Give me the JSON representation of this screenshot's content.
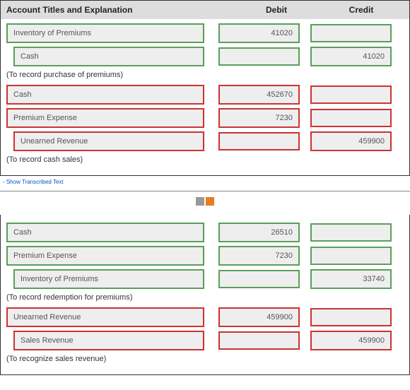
{
  "header": {
    "account_titles": "Account Titles and Explanation",
    "debit": "Debit",
    "credit": "Credit"
  },
  "section1": {
    "rows": [
      {
        "account": "Inventory of Premiums",
        "debit": "41020",
        "credit": "",
        "status": "green"
      },
      {
        "account": "Cash",
        "debit": "",
        "credit": "41020",
        "status": "green"
      }
    ],
    "caption": "(To record purchase of premiums)"
  },
  "section2": {
    "rows": [
      {
        "account": "Cash",
        "debit": "452670",
        "credit": "",
        "status": "red"
      },
      {
        "account": "Premium Expense",
        "debit": "7230",
        "credit": "",
        "status": "red"
      },
      {
        "account": "Unearned Revenue",
        "debit": "",
        "credit": "459900",
        "status": "red"
      }
    ],
    "caption": "(To record cash sales)"
  },
  "link_text": "Show Transcribed Text",
  "pager": {
    "page1": "",
    "page2": ""
  },
  "section3": {
    "rows": [
      {
        "account": "Cash",
        "debit": "26510",
        "credit": "",
        "status": "green"
      },
      {
        "account": "Premium Expense",
        "debit": "7230",
        "credit": "",
        "status": "green"
      },
      {
        "account": "Inventory of Premiums",
        "debit": "",
        "credit": "33740",
        "status": "green"
      }
    ],
    "caption": "(To record redemption for premiums)"
  },
  "section4": {
    "rows": [
      {
        "account": "Unearned Revenue",
        "debit": "459900",
        "credit": "",
        "status": "red"
      },
      {
        "account": "Sales Revenue",
        "debit": "",
        "credit": "459900",
        "status": "red"
      }
    ],
    "caption": "(To recognize sales revenue)"
  }
}
